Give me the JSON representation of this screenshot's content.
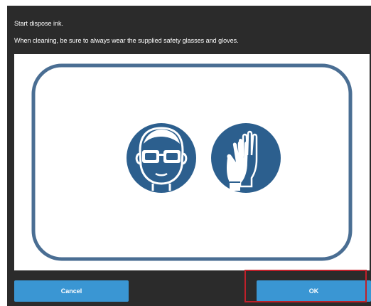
{
  "dialog": {
    "message_line1": "Start dispose ink.",
    "message_line2": "When cleaning, be sure to always wear the supplied safety glasses and gloves."
  },
  "illustration": {
    "icons": [
      "safety-glasses-icon",
      "gloves-icon"
    ],
    "frame_color": "#4a6e93",
    "icon_color": "#2c5f8e"
  },
  "buttons": {
    "cancel_label": "Cancel",
    "ok_label": "OK",
    "color": "#3a96d3"
  },
  "highlight_color": "#c0202a"
}
